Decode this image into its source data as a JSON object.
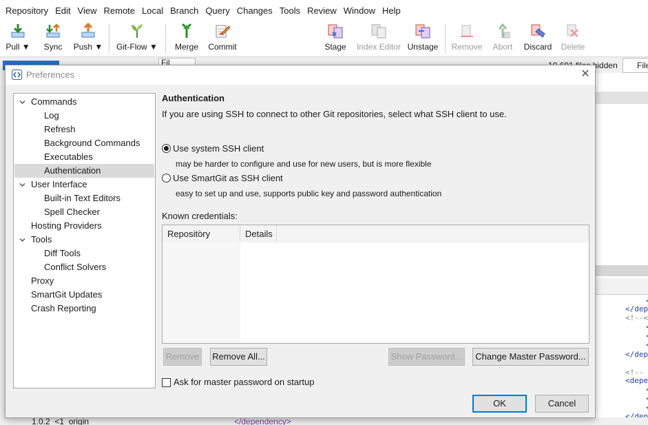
{
  "menu": [
    "Repository",
    "Edit",
    "View",
    "Remote",
    "Local",
    "Branch",
    "Query",
    "Changes",
    "Tools",
    "Review",
    "Window",
    "Help"
  ],
  "toolbar": {
    "pull": "Pull ▼",
    "sync": "Sync",
    "push": "Push ▼",
    "gitflow": "Git-Flow ▼",
    "merge": "Merge",
    "commit": "Commit",
    "stage": "Stage",
    "index_editor": "Index Editor",
    "unstage": "Unstage",
    "remove": "Remove",
    "abort": "Abort",
    "discard": "Discard",
    "delete": "Delete"
  },
  "background": {
    "files_tab": "Fil",
    "files_count": "10,691 files hidden",
    "filter": "File",
    "code": [
      "<",
      "</dep",
      "<!--<",
      "<",
      "<",
      "<",
      "</dep",
      "<!--",
      "<depe",
      "<",
      "<",
      "<",
      "</dep"
    ],
    "bottom_left": "1.0.2  <1  origin",
    "bottom_mid": "</dependency>"
  },
  "dialog": {
    "title": "Preferences",
    "close": "✕",
    "tree": [
      {
        "label": "Commands",
        "level": 0,
        "expandable": true
      },
      {
        "label": "Log",
        "level": 1
      },
      {
        "label": "Refresh",
        "level": 1
      },
      {
        "label": "Background Commands",
        "level": 1
      },
      {
        "label": "Executables",
        "level": 1
      },
      {
        "label": "Authentication",
        "level": 1,
        "selected": true
      },
      {
        "label": "User Interface",
        "level": 0,
        "expandable": true
      },
      {
        "label": "Built-in Text Editors",
        "level": 1
      },
      {
        "label": "Spell Checker",
        "level": 1
      },
      {
        "label": "Hosting Providers",
        "level": 0
      },
      {
        "label": "Tools",
        "level": 0,
        "expandable": true
      },
      {
        "label": "Diff Tools",
        "level": 1
      },
      {
        "label": "Conflict Solvers",
        "level": 1
      },
      {
        "label": "Proxy",
        "level": 0
      },
      {
        "label": "SmartGit Updates",
        "level": 0
      },
      {
        "label": "Crash Reporting",
        "level": 0
      }
    ],
    "section_title": "Authentication",
    "section_desc": "If you are using SSH to connect to other Git repositories, select what SSH client to use.",
    "radio_system": "Use system SSH client",
    "radio_system_hint": "may be harder to configure and use for new users, but is more flexible",
    "radio_smartgit": "Use SmartGit as SSH client",
    "radio_smartgit_hint": "easy to set up and use, supports public key and password authentication",
    "ssh_client_selected": "system",
    "known_credentials": "Known credentials:",
    "table_headers": [
      "Repository",
      "Details"
    ],
    "btn_remove": "Remove",
    "btn_remove_all": "Remove All...",
    "btn_show_password": "Show Password...",
    "btn_change_master": "Change Master Password...",
    "ask_master": "Ask for master password on startup",
    "btn_ok": "OK",
    "btn_cancel": "Cancel"
  }
}
